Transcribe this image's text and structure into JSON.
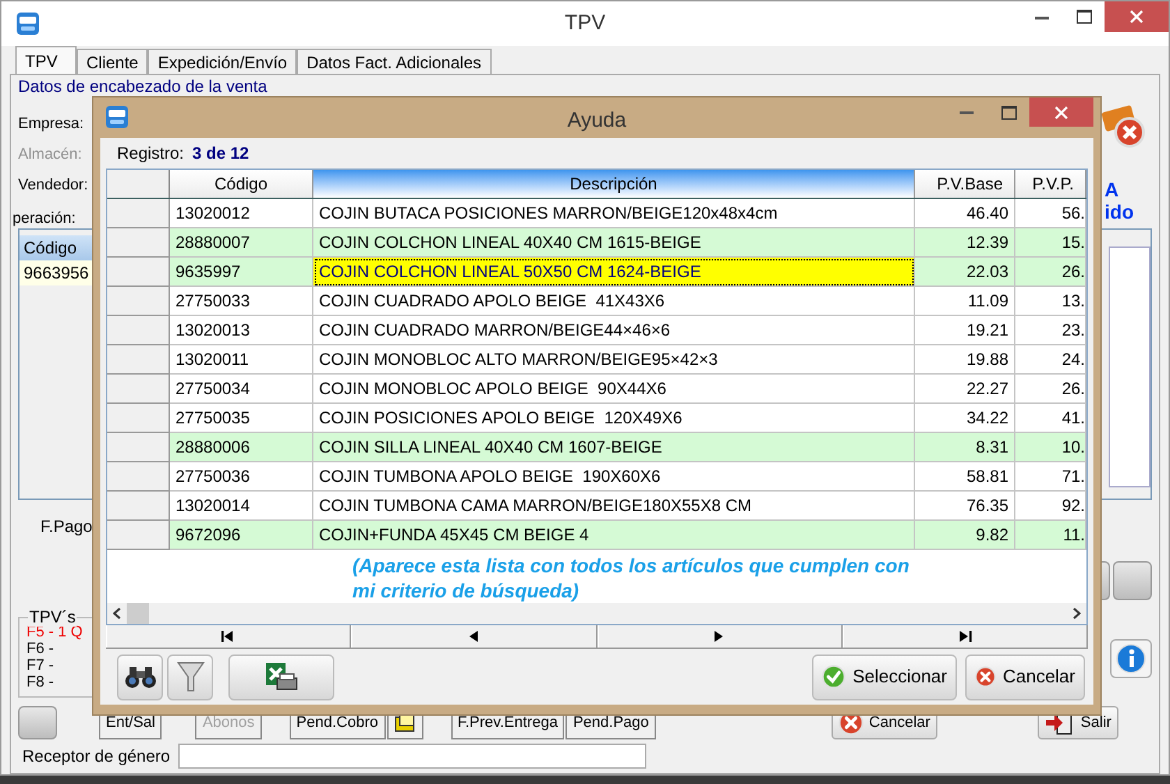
{
  "window": {
    "title": "TPV",
    "tabs": [
      {
        "label": "TPV",
        "selected": true
      },
      {
        "label": "Cliente",
        "selected": false
      },
      {
        "label": "Expedición/Envío",
        "selected": false
      },
      {
        "label": "Datos Fact. Adicionales",
        "selected": false
      }
    ]
  },
  "header": {
    "section_title": "Datos de encabezado de la venta",
    "fields": [
      {
        "label": "Empresa:",
        "disabled": false
      },
      {
        "label": "Almacén:",
        "disabled": true
      },
      {
        "label": "Vendedor:",
        "disabled": false
      },
      {
        "label": "peración:",
        "disabled": false
      }
    ]
  },
  "side_texts": [
    "A",
    "ido"
  ],
  "lines_table": {
    "columns": [
      "Código"
    ],
    "rows": [
      "9663956"
    ]
  },
  "payment_label": "F.Pago",
  "tpv_group": {
    "title": "TPV´s",
    "items": [
      {
        "label": "F5 - 1 Q",
        "active": true
      },
      {
        "label": "F6 -",
        "active": false
      },
      {
        "label": "F7 -",
        "active": false
      },
      {
        "label": "F8 -",
        "active": false
      }
    ]
  },
  "bottom_buttons": [
    {
      "label": "Ent/Sal",
      "disabled": false,
      "kind": "text"
    },
    {
      "label": "Abonos",
      "disabled": true,
      "kind": "text"
    },
    {
      "label": "Pend.Cobro",
      "disabled": false,
      "kind": "text"
    },
    {
      "kind": "folder"
    },
    {
      "label": "F.Prev.Entrega",
      "disabled": false,
      "kind": "text"
    },
    {
      "label": "Pend.Pago",
      "disabled": false,
      "kind": "text"
    },
    {
      "label": "Cancelar",
      "disabled": false,
      "kind": "cancel"
    },
    {
      "label": "Salir",
      "disabled": false,
      "kind": "exit"
    }
  ],
  "receiver": {
    "label": "Receptor de género"
  },
  "dialog": {
    "title": "Ayuda",
    "record_label": "Registro:",
    "record_value": "3 de 12",
    "columns": [
      {
        "label": "Código",
        "selected": false
      },
      {
        "label": "Descripción",
        "selected": true
      },
      {
        "label": "P.V.Base",
        "selected": false
      },
      {
        "label": "P.V.P.",
        "selected": false
      }
    ],
    "rows": [
      {
        "code": "13020012",
        "description": "COJIN BUTACA POSICIONES MARRON/BEIGE120x48x4cm",
        "base": "46.40",
        "pvp": "56.",
        "highlighted": false,
        "selected": false
      },
      {
        "code": "28880007",
        "description": "COJIN COLCHON LINEAL 40X40 CM 1615-BEIGE",
        "base": "12.39",
        "pvp": "15.",
        "highlighted": true,
        "selected": false
      },
      {
        "code": "9635997",
        "description": "COJIN COLCHON LINEAL 50X50 CM 1624-BEIGE",
        "base": "22.03",
        "pvp": "26.",
        "highlighted": true,
        "selected": true
      },
      {
        "code": "27750033",
        "description": "COJIN CUADRADO APOLO BEIGE  41X43X6",
        "base": "11.09",
        "pvp": "13.",
        "highlighted": false,
        "selected": false
      },
      {
        "code": "13020013",
        "description": "COJIN CUADRADO MARRON/BEIGE44×46×6",
        "base": "19.21",
        "pvp": "23.",
        "highlighted": false,
        "selected": false
      },
      {
        "code": "13020011",
        "description": "COJIN MONOBLOC ALTO MARRON/BEIGE95×42×3",
        "base": "19.88",
        "pvp": "24.",
        "highlighted": false,
        "selected": false
      },
      {
        "code": "27750034",
        "description": "COJIN MONOBLOC APOLO BEIGE  90X44X6",
        "base": "22.27",
        "pvp": "26.",
        "highlighted": false,
        "selected": false
      },
      {
        "code": "27750035",
        "description": "COJIN POSICIONES APOLO BEIGE  120X49X6",
        "base": "34.22",
        "pvp": "41.",
        "highlighted": false,
        "selected": false
      },
      {
        "code": "28880006",
        "description": "COJIN SILLA LINEAL 40X40 CM 1607-BEIGE",
        "base": "8.31",
        "pvp": "10.",
        "highlighted": true,
        "selected": false
      },
      {
        "code": "27750036",
        "description": "COJIN TUMBONA APOLO BEIGE  190X60X6",
        "base": "58.81",
        "pvp": "71.",
        "highlighted": false,
        "selected": false
      },
      {
        "code": "13020014",
        "description": "COJIN TUMBONA CAMA MARRON/BEIGE180X55X8 CM",
        "base": "76.35",
        "pvp": "92.",
        "highlighted": false,
        "selected": false
      },
      {
        "code": "9672096",
        "description": "COJIN+FUNDA 45X45 CM BEIGE 4",
        "base": "9.82",
        "pvp": "11.",
        "highlighted": true,
        "selected": false
      }
    ],
    "note": "(Aparece esta lista con todos los artículos que cumplen con mi criterio de búsqueda)",
    "buttons": [
      {
        "label": "Seleccionar",
        "kind": "ok"
      },
      {
        "label": "Cancelar",
        "kind": "cancel"
      }
    ]
  }
}
